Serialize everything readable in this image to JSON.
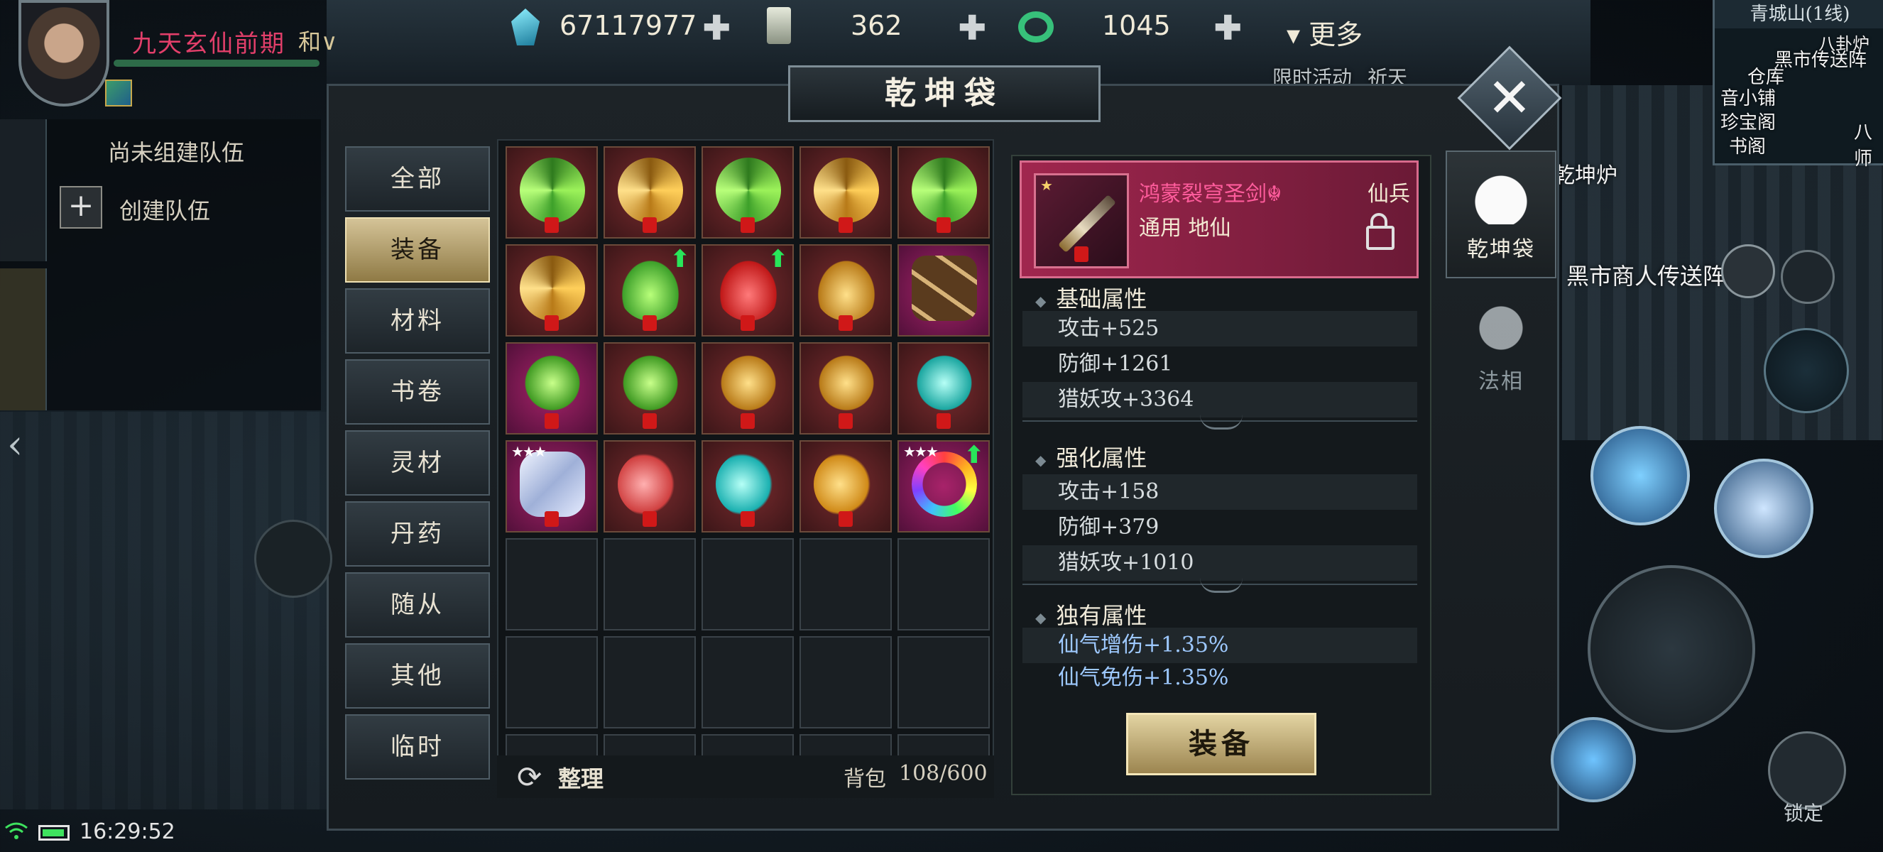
{
  "player": {
    "name": "九天玄仙前期",
    "mode": "和",
    "mode_arrow": "∨"
  },
  "currencies": [
    {
      "icon": "spirit-crystal-icon",
      "value": "67117977"
    },
    {
      "icon": "talisman-icon",
      "value": "362"
    },
    {
      "icon": "jade-ring-icon",
      "value": "1045"
    }
  ],
  "top_more": "更多",
  "top_more_arrow": "▾",
  "minimap": {
    "zone": "青城山(1线)",
    "labels": [
      "八卦炉",
      "黑市传送阵",
      "仓库",
      "音小铺",
      "珍宝阁",
      "书阁",
      "八师"
    ]
  },
  "scene_labels": [
    "限时活动",
    "祈天",
    "乾坤炉",
    "黑市商人传送阵"
  ],
  "team": {
    "empty_text": "尚未组建队伍",
    "create_label": "创建队伍",
    "create_icon": "+"
  },
  "window": {
    "title": "乾坤袋",
    "close_icon": "✕"
  },
  "categories": [
    {
      "label": "全部",
      "active": false
    },
    {
      "label": "装备",
      "active": true
    },
    {
      "label": "材料",
      "active": false
    },
    {
      "label": "书卷",
      "active": false
    },
    {
      "label": "灵材",
      "active": false
    },
    {
      "label": "丹药",
      "active": false
    },
    {
      "label": "随从",
      "active": false
    },
    {
      "label": "其他",
      "active": false
    },
    {
      "label": "临时",
      "active": false
    }
  ],
  "inventory": {
    "rows": [
      [
        {
          "icon": "green-swirl-icon",
          "bg": "red",
          "lock": true
        },
        {
          "icon": "gold-swirl-icon",
          "bg": "red",
          "lock": true
        },
        {
          "icon": "green-swirl-icon",
          "bg": "red",
          "lock": true
        },
        {
          "icon": "gold-swirl-icon",
          "bg": "red",
          "lock": true
        },
        {
          "icon": "green-swirl-icon",
          "bg": "red",
          "lock": true
        }
      ],
      [
        {
          "icon": "gold-swirl-icon",
          "bg": "red",
          "lock": true
        },
        {
          "icon": "green-flame-icon",
          "bg": "red",
          "lock": true,
          "upgrade": true
        },
        {
          "icon": "red-flame-icon",
          "bg": "red",
          "lock": true,
          "upgrade": true
        },
        {
          "icon": "gold-flame-icon",
          "bg": "red",
          "lock": true
        },
        {
          "icon": "belt-icon",
          "bg": "pink",
          "lock": false
        }
      ],
      [
        {
          "icon": "green-mask-icon",
          "bg": "pink",
          "lock": true
        },
        {
          "icon": "green-mask-icon",
          "bg": "red",
          "lock": true
        },
        {
          "icon": "gold-mask-icon",
          "bg": "red",
          "lock": true
        },
        {
          "icon": "gold-mask-icon",
          "bg": "red",
          "lock": true
        },
        {
          "icon": "cyan-mask-icon",
          "bg": "red",
          "lock": true
        }
      ],
      [
        {
          "icon": "white-ribbon-icon",
          "bg": "pink",
          "lock": true,
          "stars": "★★★"
        },
        {
          "icon": "red-dragon-icon",
          "bg": "red",
          "lock": true
        },
        {
          "icon": "cyan-dragon-icon",
          "bg": "red",
          "lock": true
        },
        {
          "icon": "gold-dragon-icon",
          "bg": "red",
          "lock": true
        },
        {
          "icon": "bead-necklace-icon",
          "bg": "pink",
          "lock": false,
          "stars": "★★★",
          "upgrade": true
        }
      ]
    ],
    "upgrade_glyph": "⬆",
    "sort_label": "整理",
    "sort_icon": "⟳",
    "bag_label": "背包",
    "bag_count": "108/600"
  },
  "detail": {
    "name": "鸿蒙裂穹圣剑",
    "name_mark": "☬",
    "type": "仙兵",
    "sub": "通用 地仙",
    "icon": "sword-icon",
    "icon_star": "★",
    "sections": [
      {
        "title": "基础属性",
        "stats": [
          "攻击+525",
          "防御+1261",
          "猎妖攻+3364"
        ]
      },
      {
        "title": "强化属性",
        "stats": [
          "攻击+158",
          "防御+379",
          "猎妖攻+1010"
        ]
      },
      {
        "title": "独有属性",
        "stats": [
          "仙气增伤+1.35%",
          "仙气免伤+1.35%"
        ]
      }
    ],
    "equip_label": "装备"
  },
  "side_tabs": [
    {
      "label": "乾坤袋",
      "icon": "bag-icon",
      "active": true
    },
    {
      "label": "法相",
      "icon": "helmet-icon",
      "active": false
    }
  ],
  "hud": {
    "lock_label": "锁定"
  },
  "status": {
    "time": "16:29:52"
  },
  "colors": {
    "accent_gold": "#d4c397",
    "item_name": "#ff5c9c",
    "upgrade": "#28e65a",
    "stat_blue": "#9ec9ff"
  }
}
